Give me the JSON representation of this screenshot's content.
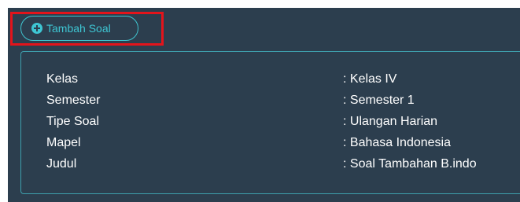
{
  "toolbar": {
    "add_question_label": "Tambah Soal"
  },
  "details": [
    {
      "label": "Kelas",
      "value": ": Kelas IV"
    },
    {
      "label": "Semester",
      "value": ": Semester 1"
    },
    {
      "label": "Tipe Soal",
      "value": ": Ulangan Harian"
    },
    {
      "label": "Mapel",
      "value": ": Bahasa Indonesia"
    },
    {
      "label": "Judul",
      "value": ": Soal Tambahan B.indo"
    }
  ],
  "colors": {
    "panel_background": "#2c3e4e",
    "accent": "#3ec6d3",
    "highlight": "#e3141b",
    "text": "#ffffff"
  },
  "icons": {
    "add_button_icon": "plus-circle-icon"
  }
}
